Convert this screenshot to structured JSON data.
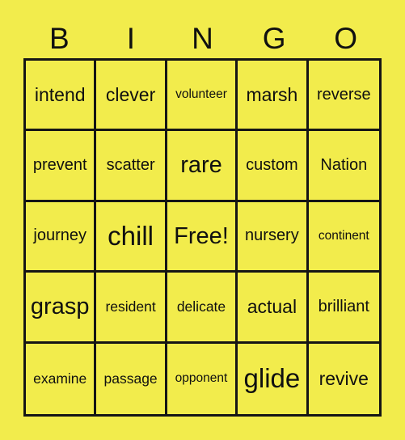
{
  "card": {
    "background_color": "#f2ec4c",
    "line_color": "#151515",
    "text_color": "#101010",
    "header": {
      "letters": [
        "B",
        "I",
        "N",
        "G",
        "O"
      ]
    },
    "grid": {
      "rows": 5,
      "columns": 5,
      "cells": [
        {
          "text": "intend",
          "size": "l"
        },
        {
          "text": "clever",
          "size": "l"
        },
        {
          "text": "volunteer",
          "size": "xs"
        },
        {
          "text": "marsh",
          "size": "l"
        },
        {
          "text": "reverse",
          "size": "m"
        },
        {
          "text": "prevent",
          "size": "m"
        },
        {
          "text": "scatter",
          "size": "m"
        },
        {
          "text": "rare",
          "size": "xl"
        },
        {
          "text": "custom",
          "size": "m"
        },
        {
          "text": "Nation",
          "size": "m"
        },
        {
          "text": "journey",
          "size": "m"
        },
        {
          "text": "chill",
          "size": "xxl"
        },
        {
          "text": "Free!",
          "size": "xl"
        },
        {
          "text": "nursery",
          "size": "m"
        },
        {
          "text": "continent",
          "size": "xs"
        },
        {
          "text": "grasp",
          "size": "xl"
        },
        {
          "text": "resident",
          "size": "s"
        },
        {
          "text": "delicate",
          "size": "s"
        },
        {
          "text": "actual",
          "size": "l"
        },
        {
          "text": "brilliant",
          "size": "m"
        },
        {
          "text": "examine",
          "size": "s"
        },
        {
          "text": "passage",
          "size": "s"
        },
        {
          "text": "opponent",
          "size": "xs"
        },
        {
          "text": "glide",
          "size": "xxl"
        },
        {
          "text": "revive",
          "size": "l"
        }
      ]
    }
  }
}
